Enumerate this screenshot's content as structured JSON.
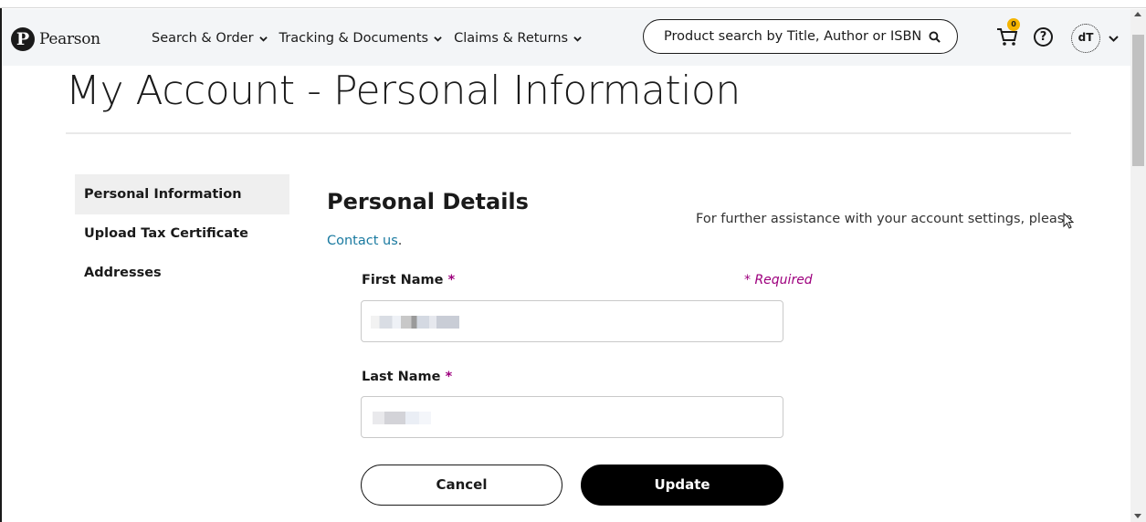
{
  "brand": {
    "name": "Pearson",
    "logo_letter": "P"
  },
  "nav": {
    "items": [
      {
        "label": "Search & Order"
      },
      {
        "label": "Tracking & Documents"
      },
      {
        "label": "Claims & Returns"
      }
    ]
  },
  "search": {
    "placeholder": "Product search by Title, Author or ISBN"
  },
  "cart": {
    "count": "0"
  },
  "help": {
    "symbol": "?"
  },
  "user": {
    "initials": "dT"
  },
  "page": {
    "title": "My Account - Personal Information"
  },
  "sidebar": {
    "items": [
      {
        "label": "Personal Information",
        "active": true
      },
      {
        "label": "Upload Tax Certificate",
        "active": false
      },
      {
        "label": "Addresses",
        "active": false
      }
    ]
  },
  "content": {
    "section_title": "Personal Details",
    "assist_text": "For further assistance with your account settings, please",
    "contact_link": "Contact us",
    "contact_suffix": ".",
    "required_note": "* Required",
    "fields": [
      {
        "label": "First Name",
        "required_mark": "*"
      },
      {
        "label": "Last Name",
        "required_mark": "*"
      }
    ]
  },
  "actions": {
    "cancel": "Cancel",
    "update": "Update"
  },
  "colors": {
    "accent": "#9e007e",
    "link": "#1a7aa0",
    "header_bg": "#f3f5f7",
    "badge": "#f4b400"
  },
  "icons": [
    "chevron-down-icon",
    "search-icon",
    "cart-icon",
    "help-icon",
    "avatar",
    "mouse-cursor-icon"
  ]
}
